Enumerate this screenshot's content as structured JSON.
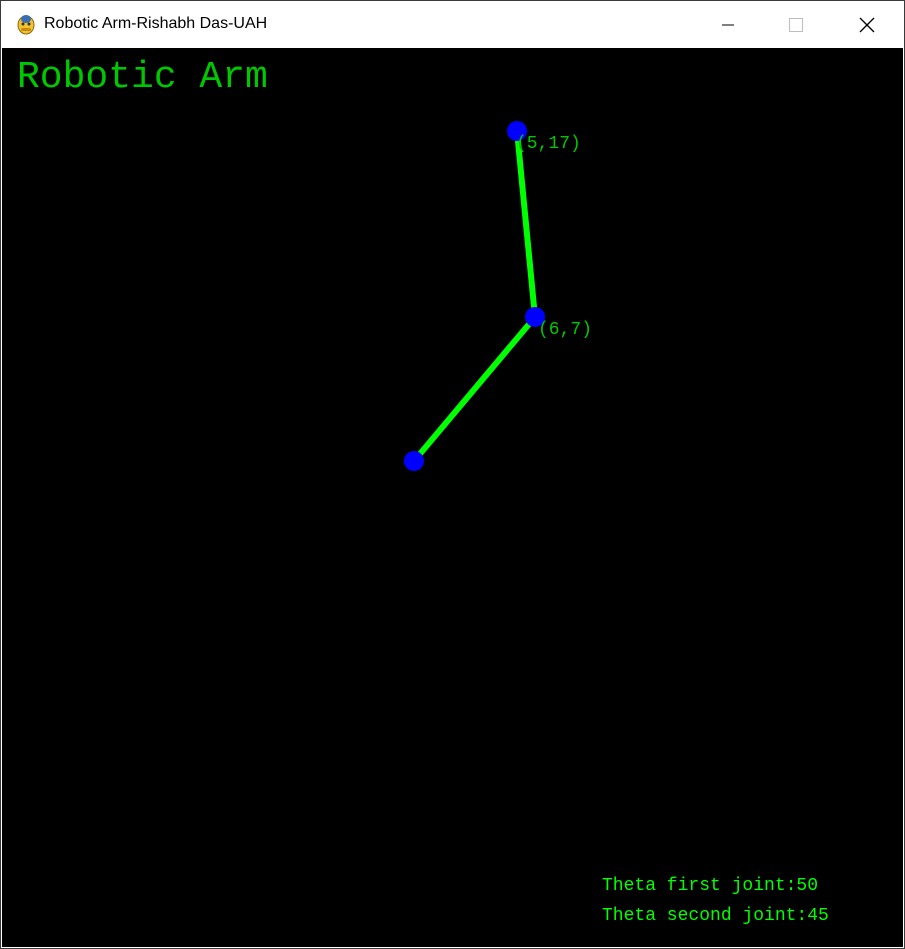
{
  "window": {
    "title": "Robotic Arm-Rishabh Das-UAH",
    "icon": "pygame-snake-icon",
    "controls": [
      "minimize-icon",
      "maximize-icon",
      "close-icon"
    ]
  },
  "canvas": {
    "background": "#000000",
    "heading": "Robotic Arm",
    "heading_color": "#00c800"
  },
  "arm": {
    "link_color": "#00ff00",
    "joint_color": "#0000ff",
    "joints": [
      {
        "name": "base",
        "label": ""
      },
      {
        "name": "elbow",
        "label": "(6,7)"
      },
      {
        "name": "end-effector",
        "label": "(5,17)"
      }
    ]
  },
  "readouts": {
    "theta_first": "Theta first joint:50",
    "theta_second": "Theta second joint:45"
  }
}
